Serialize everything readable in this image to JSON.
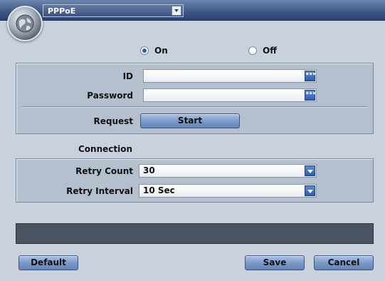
{
  "title": {
    "mode_label": "PPPoE",
    "icon": "globe-icon"
  },
  "radio": {
    "on_label": "On",
    "off_label": "Off",
    "selected": "On"
  },
  "fields": {
    "id_label": "ID",
    "id_value": "",
    "password_label": "Password",
    "password_value": "",
    "more_glyph": "•••"
  },
  "request": {
    "label": "Request",
    "button": "Start"
  },
  "connection": {
    "label": "Connection"
  },
  "retry": {
    "count_label": "Retry Count",
    "count_value": "30",
    "interval_label": "Retry Interval",
    "interval_value": "10 Sec"
  },
  "status": {
    "text": ""
  },
  "buttons": {
    "default": "Default",
    "save": "Save",
    "cancel": "Cancel"
  },
  "colors": {
    "title_bar": "#3d5785",
    "background": "#c9d1dd",
    "panel": "#b5c0cf",
    "accent": "#2c5db5"
  }
}
